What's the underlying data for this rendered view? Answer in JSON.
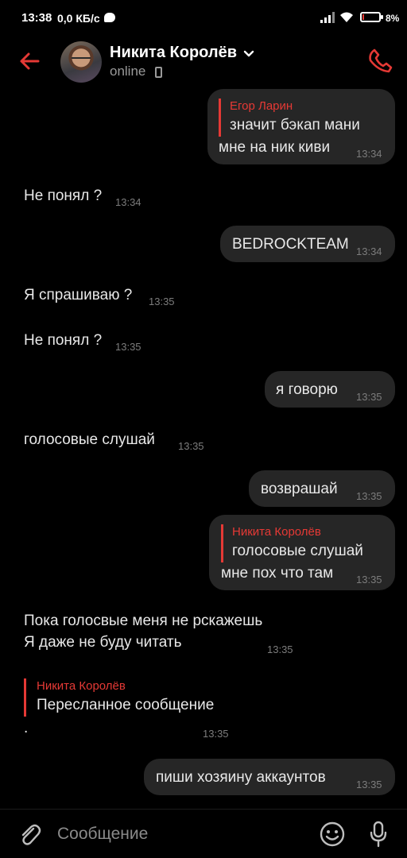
{
  "status_bar": {
    "time": "13:38",
    "speed": "0,0 КБ/с",
    "battery": "8%",
    "battery_level": 0.08,
    "message_icon": "chat-bubble-icon",
    "signal_icon": "signal-icon",
    "wifi_icon": "wifi-icon"
  },
  "header": {
    "contact_name": "Никита Королёв",
    "status": "online",
    "back_icon": "back-arrow-icon",
    "dropdown_icon": "chevron-down-icon",
    "device_icon": "mobile-phone-icon",
    "call_icon": "phone-call-icon"
  },
  "messages": [
    {
      "side": "out",
      "reply_name": "Егор Ларин",
      "reply_text": "значит бэкап мани",
      "text": "мне на ник киви",
      "time": "13:34"
    },
    {
      "side": "in",
      "text": "Не понял ?",
      "time": "13:34"
    },
    {
      "side": "out",
      "text": "BEDROCKTEAM",
      "time": "13:34"
    },
    {
      "side": "in",
      "text": "Я спрашиваю ?",
      "time": "13:35"
    },
    {
      "side": "in",
      "text": "Не понял ?",
      "time": "13:35"
    },
    {
      "side": "out",
      "text": "я говорю",
      "time": "13:35"
    },
    {
      "side": "in",
      "text": "голосовые слушай",
      "time": "13:35"
    },
    {
      "side": "out",
      "text": "возврашай",
      "time": "13:35"
    },
    {
      "side": "out",
      "reply_name": "Никита Королёв",
      "reply_text": "голосовые слушай",
      "text": "мне пох что там",
      "time": "13:35"
    },
    {
      "side": "in",
      "line1": "Пока голосвые меня не рскажешь",
      "line2": "Я даже не буду читать",
      "time": "13:35"
    },
    {
      "side": "in",
      "fwd_name": "Никита Королёв",
      "fwd_text": "Пересланное сообщение",
      "text": ".",
      "time": "13:35"
    },
    {
      "side": "out",
      "text": "пиши хозяину аккаунтов",
      "time": "13:35"
    }
  ],
  "input": {
    "placeholder": "Сообщение",
    "attach_icon": "paperclip-icon",
    "emoji_icon": "emoji-icon",
    "mic_icon": "microphone-icon"
  },
  "colors": {
    "accent": "#e53935",
    "background": "#000000",
    "bubble": "#262626",
    "muted": "#9a9a9a"
  }
}
